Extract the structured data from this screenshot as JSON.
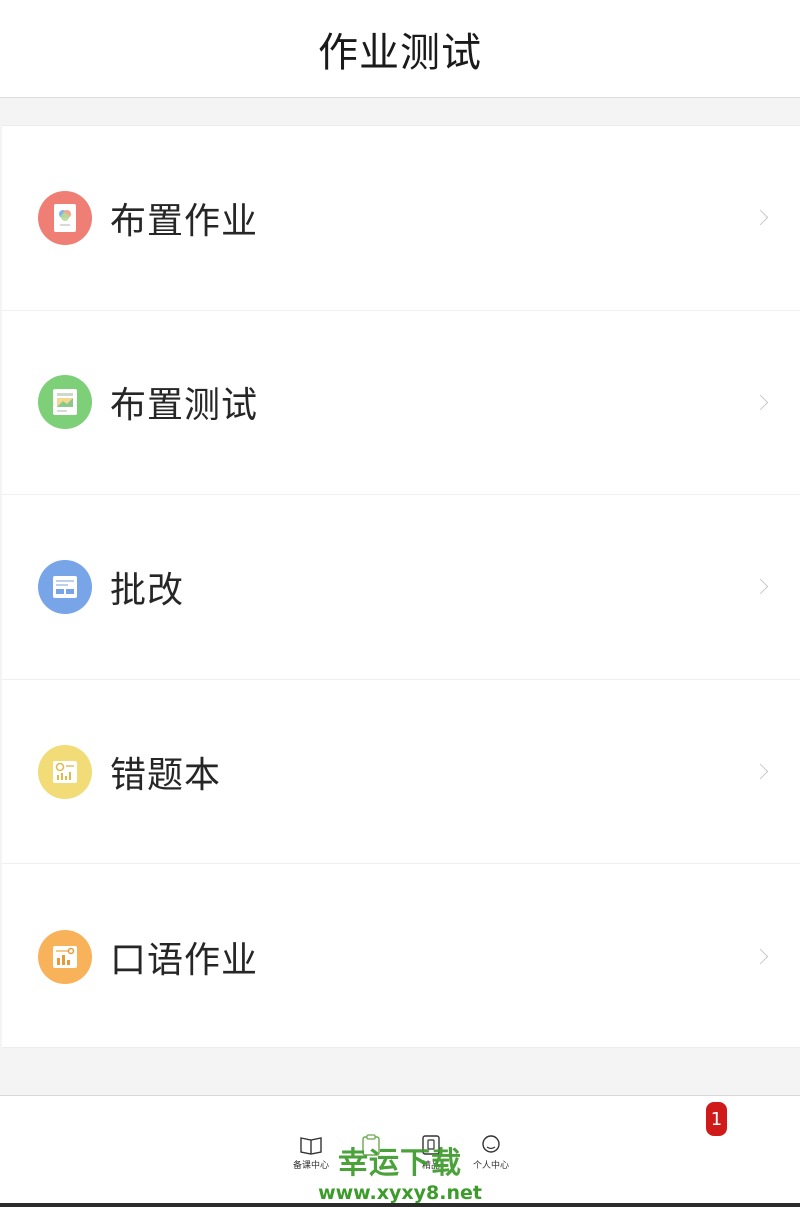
{
  "header": {
    "title": "作业测试"
  },
  "menu": {
    "items": [
      {
        "label": "布置作业",
        "icon": "assign-homework-icon",
        "color": "#ef7f74"
      },
      {
        "label": "布置测试",
        "icon": "assign-test-icon",
        "color": "#7dcf78"
      },
      {
        "label": "批改",
        "icon": "grading-icon",
        "color": "#78a5e8"
      },
      {
        "label": "错题本",
        "icon": "mistake-book-icon",
        "color": "#f1dc78"
      },
      {
        "label": "口语作业",
        "icon": "oral-homework-icon",
        "color": "#f8b25a"
      }
    ]
  },
  "tabbar": {
    "tabs": [
      {
        "label": "备课中心",
        "icon": "book-icon"
      },
      {
        "label": "",
        "icon": "clipboard-icon"
      },
      {
        "label": "精品",
        "icon": "premium-icon"
      },
      {
        "label": "个人中心",
        "icon": "profile-icon"
      }
    ],
    "badge": "1"
  },
  "watermark": {
    "title": "幸运下载",
    "url": "www.xyxy8.net"
  },
  "colors": {
    "accent_green": "#3c9b2a",
    "badge_red": "#d01a1a"
  }
}
